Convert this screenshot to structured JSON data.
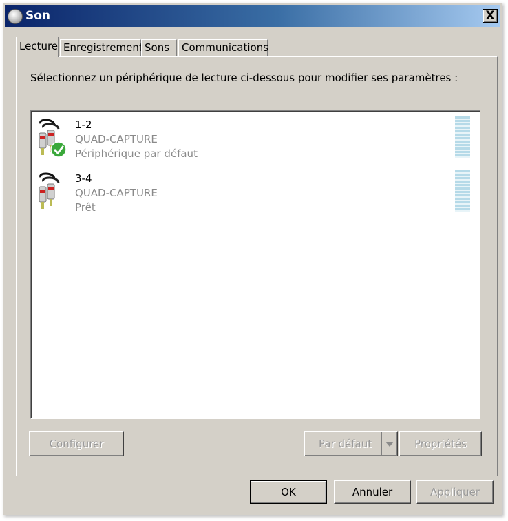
{
  "window": {
    "title": "Son",
    "close_label": "X"
  },
  "tabs": [
    {
      "label": "Lecture"
    },
    {
      "label": "Enregistrement"
    },
    {
      "label": "Sons"
    },
    {
      "label": "Communications"
    }
  ],
  "playback": {
    "instruction": "Sélectionnez un périphérique de lecture ci-dessous pour modifier ses paramètres :",
    "devices": [
      {
        "name": "1-2",
        "model": "QUAD-CAPTURE",
        "status": "Périphérique par défaut",
        "is_default": true,
        "icon": "rca-cable-icon"
      },
      {
        "name": "3-4",
        "model": "QUAD-CAPTURE",
        "status": "Prêt",
        "is_default": false,
        "icon": "rca-cable-icon"
      }
    ],
    "configure_label": "Configurer",
    "set_default_label": "Par défaut",
    "properties_label": "Propriétés"
  },
  "footer": {
    "ok_label": "OK",
    "cancel_label": "Annuler",
    "apply_label": "Appliquer"
  },
  "colors": {
    "dialog_bg": "#d4d0c8",
    "title_gradient_start": "#0a246a",
    "title_gradient_end": "#a6caf0",
    "muted_text": "#8a8a8a",
    "level_meter": "#b6dae8",
    "check_green": "#3aa83a"
  }
}
